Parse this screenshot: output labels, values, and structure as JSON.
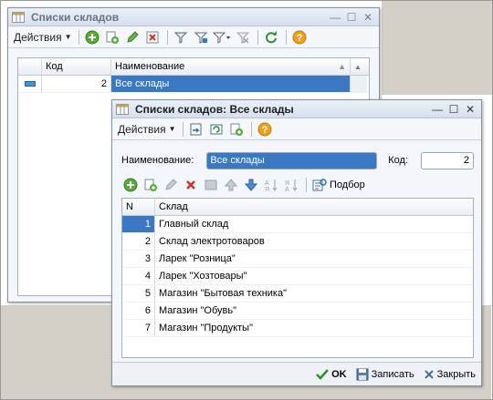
{
  "list_window": {
    "title": "Списки складов",
    "actions_label": "Действия",
    "columns": [
      "Код",
      "Наименование"
    ],
    "rows": [
      {
        "code": "2",
        "name": "Все склады"
      }
    ]
  },
  "item_window": {
    "title": "Списки складов: Все склады",
    "actions_label": "Действия",
    "name_label": "Наименование:",
    "name_value": "Все склады",
    "code_label": "Код:",
    "code_value": "2",
    "podbor_label": "Подбор",
    "columns": [
      "N",
      "Склад"
    ],
    "rows": [
      {
        "n": "1",
        "name": "Главный склад"
      },
      {
        "n": "2",
        "name": "Склад электротоваров"
      },
      {
        "n": "3",
        "name": "Ларек \"Розница\""
      },
      {
        "n": "4",
        "name": "Ларек \"Хозтовары\""
      },
      {
        "n": "5",
        "name": "Магазин \"Бытовая техника\""
      },
      {
        "n": "6",
        "name": "Магазин \"Обувь\""
      },
      {
        "n": "7",
        "name": "Магазин \"Продукты\""
      }
    ],
    "footer": {
      "ok": "OK",
      "save": "Записать",
      "close": "Закрыть"
    }
  },
  "colors": {
    "selection": "#3b78c4",
    "title_bar": "#d7e1ee",
    "window_bg": "#f3f6fb"
  }
}
